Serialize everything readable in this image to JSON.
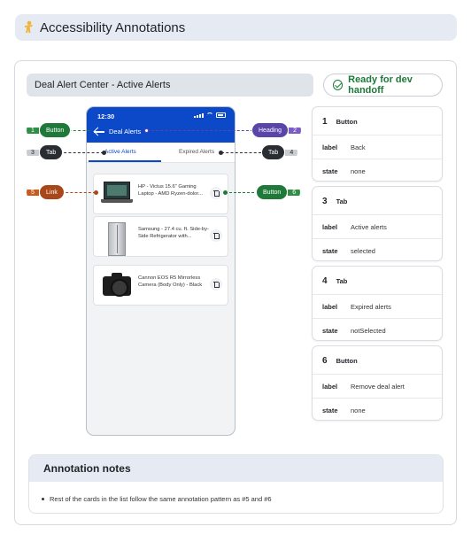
{
  "header": {
    "icon": "accessibility-emoji-icon",
    "title": "Accessibility Annotations"
  },
  "screen": {
    "title": "Deal Alert Center - Active Alerts"
  },
  "status": {
    "label": "Ready for dev handoff",
    "icon": "check-circle-icon",
    "color": "#1b7a3a"
  },
  "phone": {
    "time": "12:30",
    "nav_title": "Deal Alerts",
    "tabs": [
      {
        "label": "Active Alerts",
        "selected": true
      },
      {
        "label": "Expired Alerts",
        "selected": false
      }
    ],
    "cards": [
      {
        "image": "laptop",
        "text": "HP - Victus 15.6\" Gaming Laptop - AMD Ryzen-dolor..."
      },
      {
        "image": "refrigerator",
        "text": "Samsung - 27.4 cu. ft. Side-by-Side Refrigerator with..."
      },
      {
        "image": "camera",
        "text": "Cannon EOS R5 Mirrorless Camera (Body Only) - Black"
      }
    ],
    "accent": "#0b49c8"
  },
  "callouts": [
    {
      "num": "1",
      "label": "Button",
      "color": "#1f7a3a"
    },
    {
      "num": "2",
      "label": "Heading",
      "color": "#5b45a8"
    },
    {
      "num": "3",
      "label": "Tab",
      "color": "#2a2d31"
    },
    {
      "num": "4",
      "label": "Tab",
      "color": "#2a2d31"
    },
    {
      "num": "5",
      "label": "Link",
      "color": "#a8481a"
    },
    {
      "num": "6",
      "label": "Button",
      "color": "#1f7a3a"
    }
  ],
  "annotations": [
    {
      "num": "1",
      "type": "Button",
      "rows": [
        {
          "key": "label",
          "value": "Back"
        },
        {
          "key": "state",
          "value": "none"
        }
      ]
    },
    {
      "num": "3",
      "type": "Tab",
      "rows": [
        {
          "key": "label",
          "value": "Active alerts"
        },
        {
          "key": "state",
          "value": "selected"
        }
      ]
    },
    {
      "num": "4",
      "type": "Tab",
      "rows": [
        {
          "key": "label",
          "value": "Expired alerts"
        },
        {
          "key": "state",
          "value": "notSelected"
        }
      ]
    },
    {
      "num": "6",
      "type": "Button",
      "rows": [
        {
          "key": "label",
          "value": "Remove deal alert"
        },
        {
          "key": "state",
          "value": "none"
        }
      ]
    }
  ],
  "notes": {
    "title": "Annotation notes",
    "items": [
      "Rest of the cards in the list follow the same annotation pattern as #5 and #6"
    ]
  }
}
